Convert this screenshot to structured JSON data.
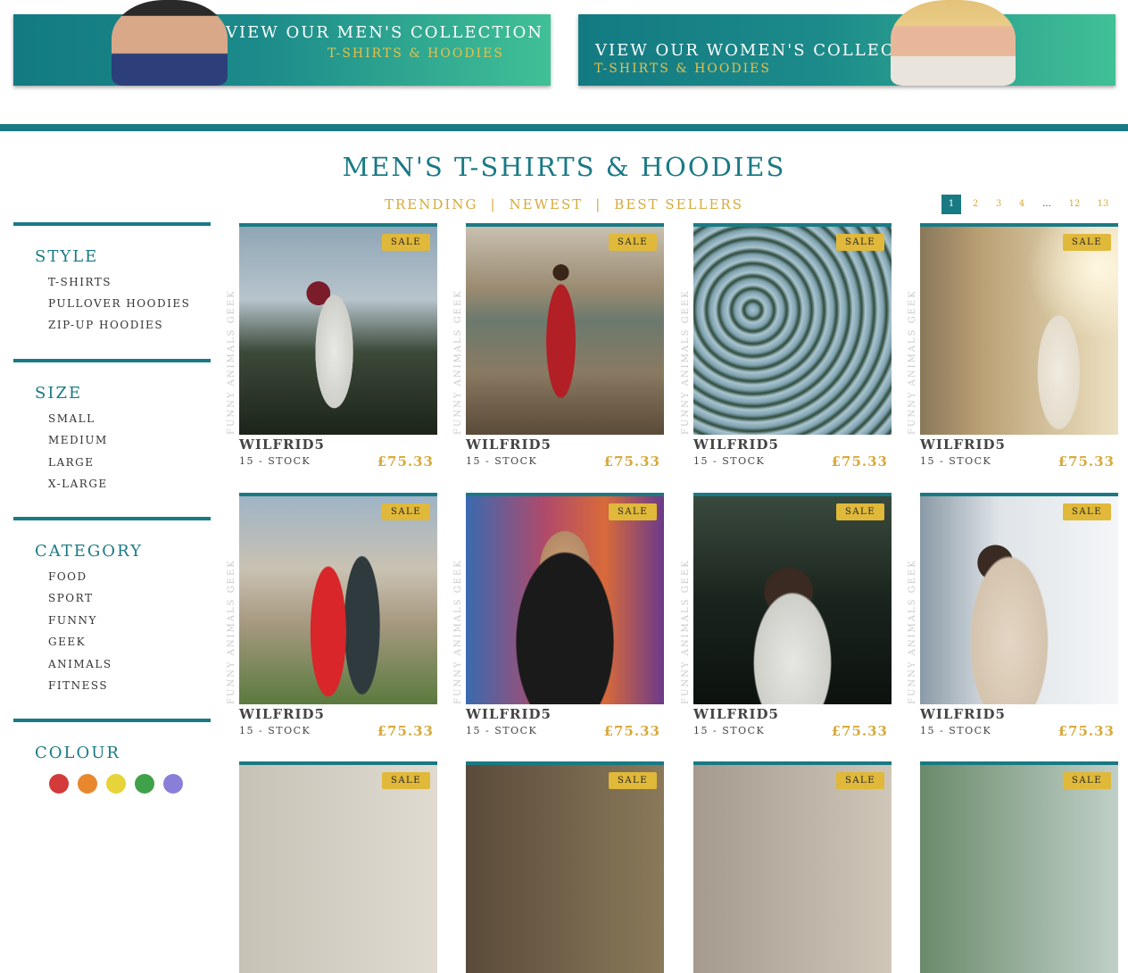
{
  "banners": {
    "men": {
      "title": "VIEW OUR MEN'S COLLECTION",
      "subtitle": "T-SHIRTS & HOODIES"
    },
    "women": {
      "title": "VIEW OUR WOMEN'S COLLECTION",
      "subtitle": "T-SHIRTS & HOODIES"
    }
  },
  "page": {
    "title": "MEN'S T-SHIRTS & HOODIES"
  },
  "sort": {
    "trending": "TRENDING",
    "newest": "NEWEST",
    "best_sellers": "BEST SELLERS",
    "separator": "|"
  },
  "pagination": [
    "1",
    "2",
    "3",
    "4",
    "...",
    "12",
    "13"
  ],
  "filters": {
    "style": {
      "title": "STYLE",
      "options": [
        "T-SHIRTS",
        "PULLOVER HOODIES",
        "ZIP-UP HOODIES"
      ]
    },
    "size": {
      "title": "SIZE",
      "options": [
        "SMALL",
        "MEDIUM",
        "LARGE",
        "X-LARGE"
      ]
    },
    "category": {
      "title": "CATEGORY",
      "options": [
        "FOOD",
        "SPORT",
        "FUNNY",
        "GEEK",
        "ANIMALS",
        "FITNESS"
      ]
    },
    "colour": {
      "title": "COLOUR",
      "swatches": [
        "#d33a3a",
        "#e9872e",
        "#e6d43a",
        "#3fa24a",
        "#8a7fd8"
      ]
    }
  },
  "products": [
    {
      "badge": "SALE",
      "tags": "FUNNY  ANIMALS  GEEK",
      "name": "WILFRID5",
      "stock": "15 - STOCK",
      "price": "£75.33",
      "scene": "bride-sky"
    },
    {
      "badge": "SALE",
      "tags": "FUNNY  ANIMALS  GEEK",
      "name": "WILFRID5",
      "stock": "15 - STOCK",
      "price": "£75.33",
      "scene": "red-dress-lake"
    },
    {
      "badge": "SALE",
      "tags": "FUNNY  ANIMALS  GEEK",
      "name": "WILFRID5",
      "stock": "15 - STOCK",
      "price": "£75.33",
      "scene": "succulents"
    },
    {
      "badge": "SALE",
      "tags": "FUNNY  ANIMALS  GEEK",
      "name": "WILFRID5",
      "stock": "15 - STOCK",
      "price": "£75.33",
      "scene": "forest-woman"
    },
    {
      "badge": "SALE",
      "tags": "FUNNY  ANIMALS  GEEK",
      "name": "WILFRID5",
      "stock": "15 - STOCK",
      "price": "£75.33",
      "scene": "colosseum-couple"
    },
    {
      "badge": "SALE",
      "tags": "FUNNY  ANIMALS  GEEK",
      "name": "WILFRID5",
      "stock": "15 - STOCK",
      "price": "£75.33",
      "scene": "city-lights"
    },
    {
      "badge": "SALE",
      "tags": "FUNNY  ANIMALS  GEEK",
      "name": "WILFRID5",
      "stock": "15 - STOCK",
      "price": "£75.33",
      "scene": "dark-forest"
    },
    {
      "badge": "SALE",
      "tags": "FUNNY  ANIMALS  GEEK",
      "name": "WILFRID5",
      "stock": "15 - STOCK",
      "price": "£75.33",
      "scene": "bright-city"
    },
    {
      "badge": "SALE",
      "scene": "partial-1"
    },
    {
      "badge": "SALE",
      "scene": "partial-2"
    },
    {
      "badge": "SALE",
      "scene": "partial-3"
    },
    {
      "badge": "SALE",
      "scene": "partial-4"
    }
  ]
}
